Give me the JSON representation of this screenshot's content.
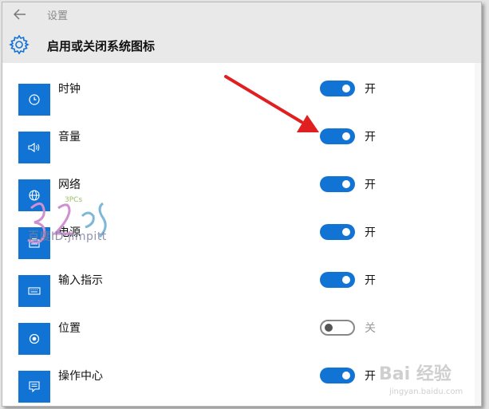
{
  "window": {
    "title": "设置"
  },
  "header": {
    "page_title": "启用或关闭系统图标"
  },
  "items": [
    {
      "label": "时钟",
      "icon": "clock-icon",
      "state": "开",
      "on": true
    },
    {
      "label": "音量",
      "icon": "volume-icon",
      "state": "开",
      "on": true
    },
    {
      "label": "网络",
      "icon": "network-icon",
      "state": "开",
      "on": true
    },
    {
      "label": "电源",
      "icon": "battery-icon",
      "state": "开",
      "on": true
    },
    {
      "label": "输入指示",
      "icon": "keyboard-icon",
      "state": "开",
      "on": true
    },
    {
      "label": "位置",
      "icon": "location-icon",
      "state": "关",
      "on": false
    },
    {
      "label": "操作中心",
      "icon": "action-center-icon",
      "state": "开",
      "on": true
    }
  ],
  "watermarks": {
    "left_text": "百度ID:jimpitt",
    "right_text": "Bai 经验",
    "right_sub": "jingyan.baidu.com"
  },
  "colors": {
    "accent": "#1173d4",
    "annotation_arrow": "#e02020"
  }
}
